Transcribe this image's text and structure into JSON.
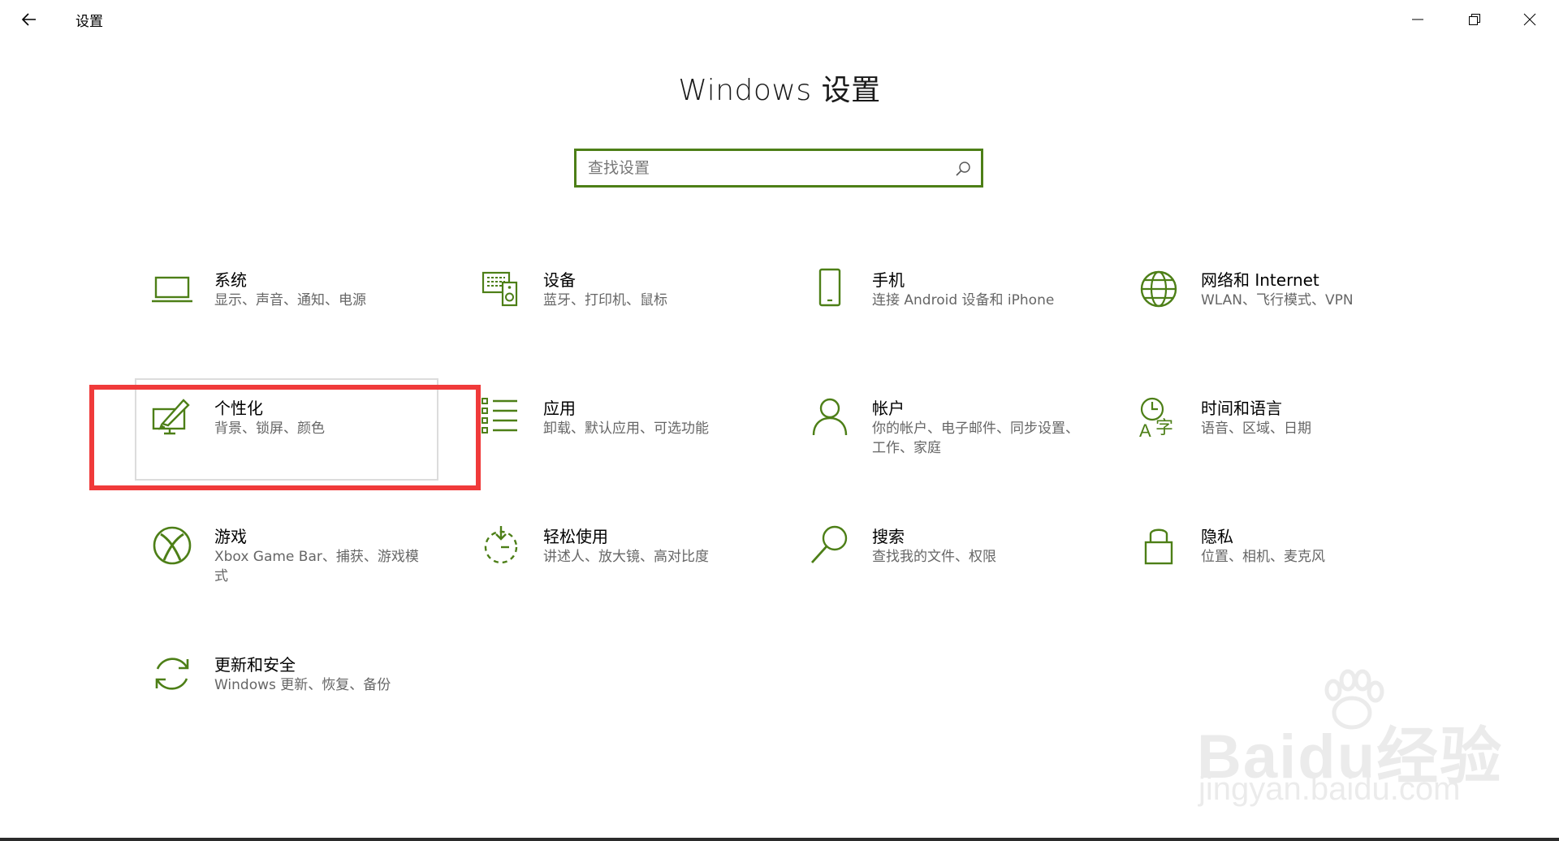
{
  "window": {
    "title": "设置",
    "accent_color": "#4d7f17",
    "controls": {
      "minimize": "minimize-icon",
      "maximize": "restore-icon",
      "close": "close-icon"
    }
  },
  "header": {
    "title": "Windows 设置"
  },
  "search": {
    "placeholder": "查找设置",
    "value": ""
  },
  "items": [
    {
      "label": "系统",
      "desc": "显示、声音、通知、电源",
      "icon": "laptop-icon"
    },
    {
      "label": "设备",
      "desc": "蓝牙、打印机、鼠标",
      "icon": "devices-icon"
    },
    {
      "label": "手机",
      "desc": "连接 Android 设备和 iPhone",
      "icon": "phone-icon"
    },
    {
      "label": "网络和 Internet",
      "desc": "WLAN、飞行模式、VPN",
      "icon": "globe-icon"
    },
    {
      "label": "个性化",
      "desc": "背景、锁屏、颜色",
      "icon": "personalization-icon"
    },
    {
      "label": "应用",
      "desc": "卸载、默认应用、可选功能",
      "icon": "apps-list-icon"
    },
    {
      "label": "帐户",
      "desc": "你的帐户、电子邮件、同步设置、工作、家庭",
      "icon": "person-icon"
    },
    {
      "label": "时间和语言",
      "desc": "语音、区域、日期",
      "icon": "time-language-icon"
    },
    {
      "label": "游戏",
      "desc": "Xbox Game Bar、捕获、游戏模式",
      "icon": "xbox-icon"
    },
    {
      "label": "轻松使用",
      "desc": "讲述人、放大镜、高对比度",
      "icon": "ease-of-access-icon"
    },
    {
      "label": "搜索",
      "desc": "查找我的文件、权限",
      "icon": "search-magnifier-icon"
    },
    {
      "label": "隐私",
      "desc": "位置、相机、麦克风",
      "icon": "lock-icon"
    },
    {
      "label": "更新和安全",
      "desc": "Windows 更新、恢复、备份",
      "icon": "sync-icon"
    }
  ],
  "watermark": {
    "text": "Baidu经验",
    "subtext": "jingyan.baidu.com",
    "color": "#888888"
  },
  "annotation": {
    "color": "#f03a3a",
    "target": "个性化"
  }
}
